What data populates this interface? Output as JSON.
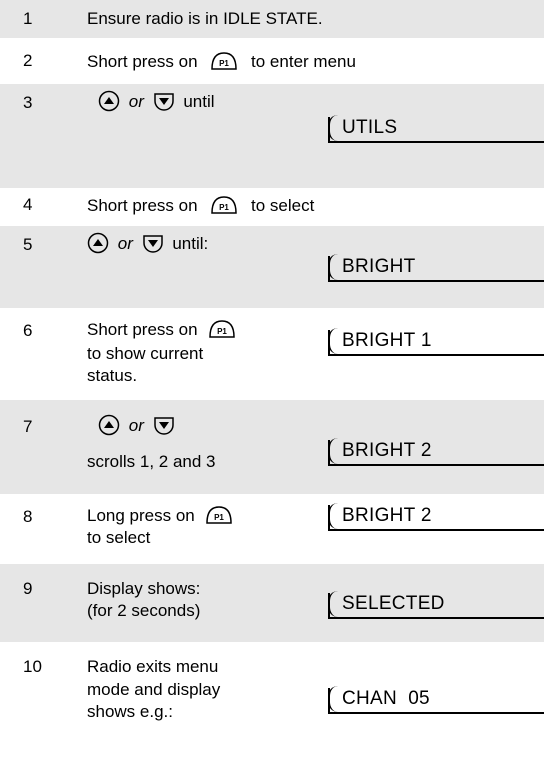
{
  "steps": [
    {
      "num": "1",
      "text": "Ensure radio is in IDLE STATE."
    },
    {
      "num": "2",
      "pre": "Short press on",
      "post": "to enter menu",
      "key": "P1"
    },
    {
      "num": "3",
      "or": "or",
      "post": "until",
      "display": "UTILS"
    },
    {
      "num": "4",
      "pre": "Short press on",
      "post": "to select",
      "key": "P1"
    },
    {
      "num": "5",
      "or": "or",
      "post": "until:",
      "display": "BRIGHT"
    },
    {
      "num": "6",
      "pre": "Short press on",
      "line2": "to show current",
      "line3": "status.",
      "key": "P1",
      "display": "BRIGHT 1"
    },
    {
      "num": "7",
      "or": "or",
      "line2": "scrolls 1, 2 and 3",
      "display": "BRIGHT 2"
    },
    {
      "num": "8",
      "pre": "Long press on",
      "line2": "to select",
      "key": "P1",
      "display": "BRIGHT 2"
    },
    {
      "num": "9",
      "line1": "Display shows:",
      "line2": "(for 2 seconds)",
      "display": "SELECTED"
    },
    {
      "num": "10",
      "line1": "Radio exits menu",
      "line2": "mode and display",
      "line3": "shows e.g.:",
      "display": "CHAN  05"
    }
  ],
  "icons": {
    "p1_key": "p1-key-icon",
    "up_key": "up-arrow-key-icon",
    "down_key": "down-arrow-key-icon"
  }
}
